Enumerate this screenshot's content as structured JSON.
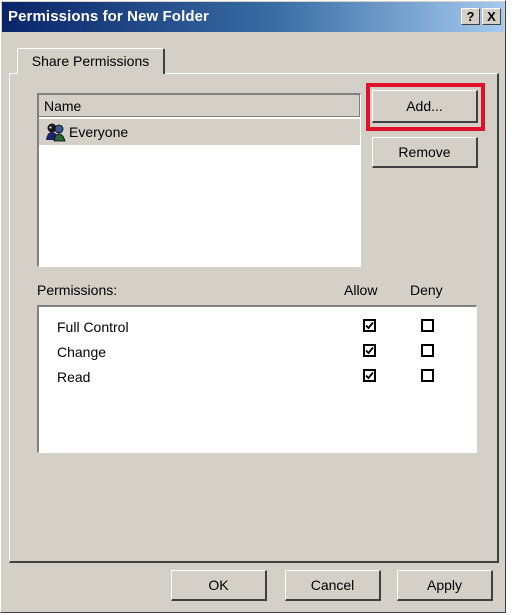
{
  "window": {
    "title": "Permissions for New Folder",
    "help_label": "?",
    "close_label": "X"
  },
  "tab": {
    "label": "Share Permissions"
  },
  "users_list": {
    "header": "Name",
    "items": [
      {
        "label": "Everyone",
        "icon": "user-group-icon"
      }
    ]
  },
  "user_buttons": {
    "add": "Add...",
    "remove": "Remove"
  },
  "permissions": {
    "heading": "Permissions:",
    "allow_header": "Allow",
    "deny_header": "Deny",
    "rows": [
      {
        "label": "Full Control",
        "allow": true,
        "deny": false
      },
      {
        "label": "Change",
        "allow": true,
        "deny": false
      },
      {
        "label": "Read",
        "allow": true,
        "deny": false
      }
    ]
  },
  "footer": {
    "ok": "OK",
    "cancel": "Cancel",
    "apply": "Apply"
  },
  "colors": {
    "highlight": "#e0102a",
    "title_gradient_start": "#0a246a",
    "dialog_face": "#d4d0c8"
  }
}
